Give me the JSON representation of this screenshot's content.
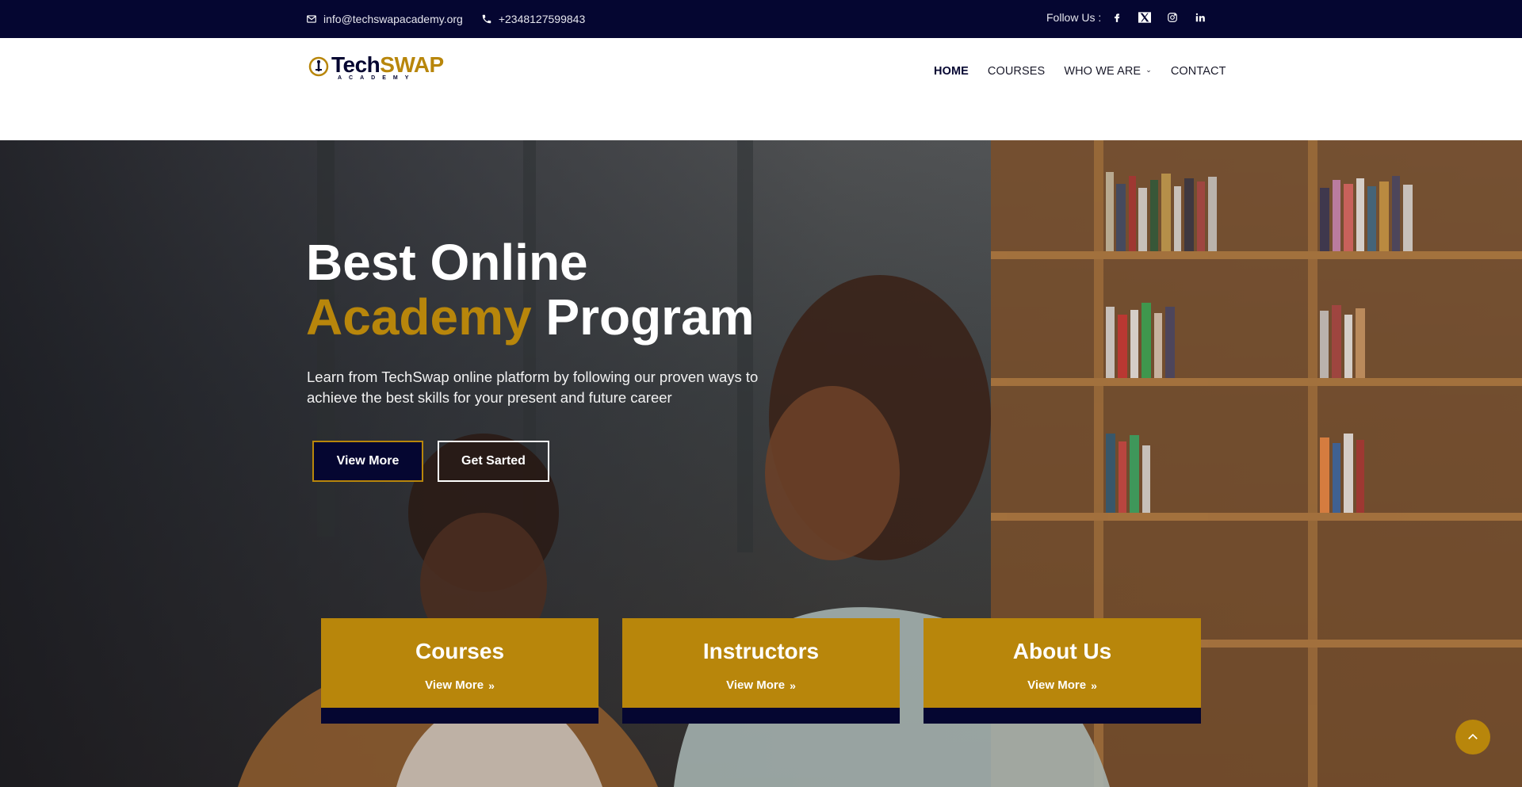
{
  "topbar": {
    "email": "info@techswapacademy.org",
    "phone": "+2348127599843",
    "follow_label": "Follow Us :",
    "socials": [
      "facebook-icon",
      "x-icon",
      "instagram-icon",
      "linkedin-icon"
    ]
  },
  "header": {
    "logo_text_1": "Tech",
    "logo_text_2": "SWAP",
    "logo_sub": "ACADEMY",
    "nav": [
      {
        "label": "HOME",
        "active": true
      },
      {
        "label": "COURSES"
      },
      {
        "label": "WHO WE ARE",
        "dropdown": true
      },
      {
        "label": "CONTACT"
      }
    ]
  },
  "hero": {
    "title_line1": "Best Online",
    "title_gold": "Academy",
    "title_rest": " Program",
    "description": "Learn from TechSwap online platform by following our proven ways to achieve the best skills for your present and future career",
    "btn_view": "View More",
    "btn_start": "Get Sarted"
  },
  "cards": [
    {
      "title": "Courses",
      "link": "View More"
    },
    {
      "title": "Instructors",
      "link": "View More"
    },
    {
      "title": "About Us",
      "link": "View More"
    }
  ],
  "colors": {
    "navy": "#050631",
    "gold": "#b8860b",
    "white": "#ffffff"
  }
}
